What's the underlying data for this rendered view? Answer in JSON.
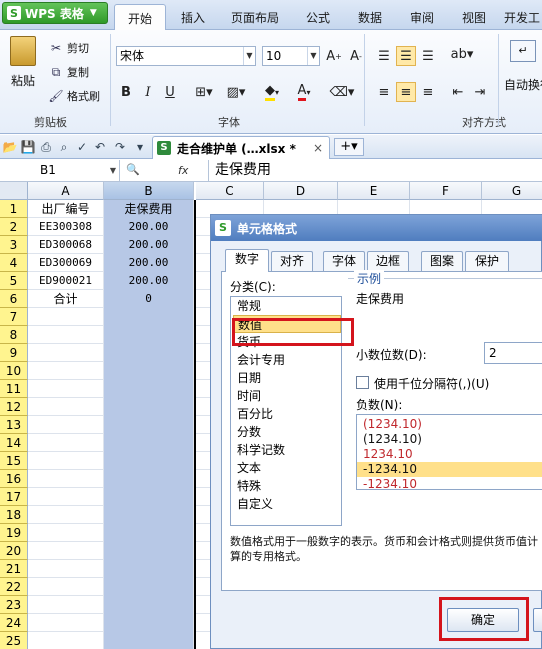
{
  "app": {
    "button_label": "WPS 表格"
  },
  "ribbon": {
    "tabs": [
      "开始",
      "插入",
      "页面布局",
      "公式",
      "数据",
      "审阅",
      "视图",
      "开发工"
    ],
    "active_tab": "开始",
    "clipboard": {
      "paste": "粘贴",
      "cut": "剪切",
      "copy": "复制",
      "format_painter": "格式刷",
      "group_label": "剪贴板"
    },
    "font": {
      "name": "宋体",
      "size": "10",
      "bold": "B",
      "italic": "I",
      "underline": "U",
      "group_label": "字体"
    },
    "align": {
      "wrap": "自动换行",
      "group_label": "对齐方式"
    }
  },
  "document": {
    "tab_title": "走合维护单 (…xlsx *",
    "close": "×"
  },
  "formula_bar": {
    "name_box": "B1",
    "fx": "fx",
    "content": "走保费用"
  },
  "sheet": {
    "columns": [
      "A",
      "B",
      "C",
      "D",
      "E",
      "F",
      "G"
    ],
    "selected_column": "B",
    "rows": [
      "1",
      "2",
      "3",
      "4",
      "5",
      "6",
      "7",
      "8",
      "9",
      "10",
      "11",
      "12",
      "13",
      "14",
      "15",
      "16",
      "17",
      "18",
      "19",
      "20",
      "21",
      "22",
      "23",
      "24",
      "25"
    ],
    "data": [
      [
        "出厂编号",
        "走保费用"
      ],
      [
        "EE300308",
        "200.00"
      ],
      [
        "ED300068",
        "200.00"
      ],
      [
        "ED300069",
        "200.00"
      ],
      [
        "ED900021",
        "200.00"
      ],
      [
        "合计",
        "0"
      ]
    ]
  },
  "dialog": {
    "title": "单元格格式",
    "tabs": [
      "数字",
      "对齐",
      "字体",
      "边框",
      "图案",
      "保护"
    ],
    "active_tab": "数字",
    "category_label": "分类(C):",
    "categories": [
      "常规",
      "数值",
      "货币",
      "会计专用",
      "日期",
      "时间",
      "百分比",
      "分数",
      "科学记数",
      "文本",
      "特殊",
      "自定义"
    ],
    "selected_category": "数值",
    "sample_label": "示例",
    "sample_value": "走保费用",
    "decimal_label": "小数位数(D):",
    "decimal_value": "2",
    "thousands_label": "使用千位分隔符(,)(U)",
    "negative_label": "负数(N):",
    "negatives": [
      "(1234.10)",
      "(1234.10)",
      "1234.10",
      "-1234.10",
      "-1234.10"
    ],
    "negative_colors": [
      "#c0282d",
      "#111111",
      "#c0282d",
      "#111111",
      "#c0282d"
    ],
    "selected_negative_index": 3,
    "description": "数值格式用于一般数字的表示。货币和会计格式则提供货币值计算的专用格式。",
    "ok_label": "确定"
  },
  "colors": {
    "accent_red": "#d4141c",
    "selection_blue": "#b7c8e6",
    "row_header_yellow": "#fff48f"
  }
}
